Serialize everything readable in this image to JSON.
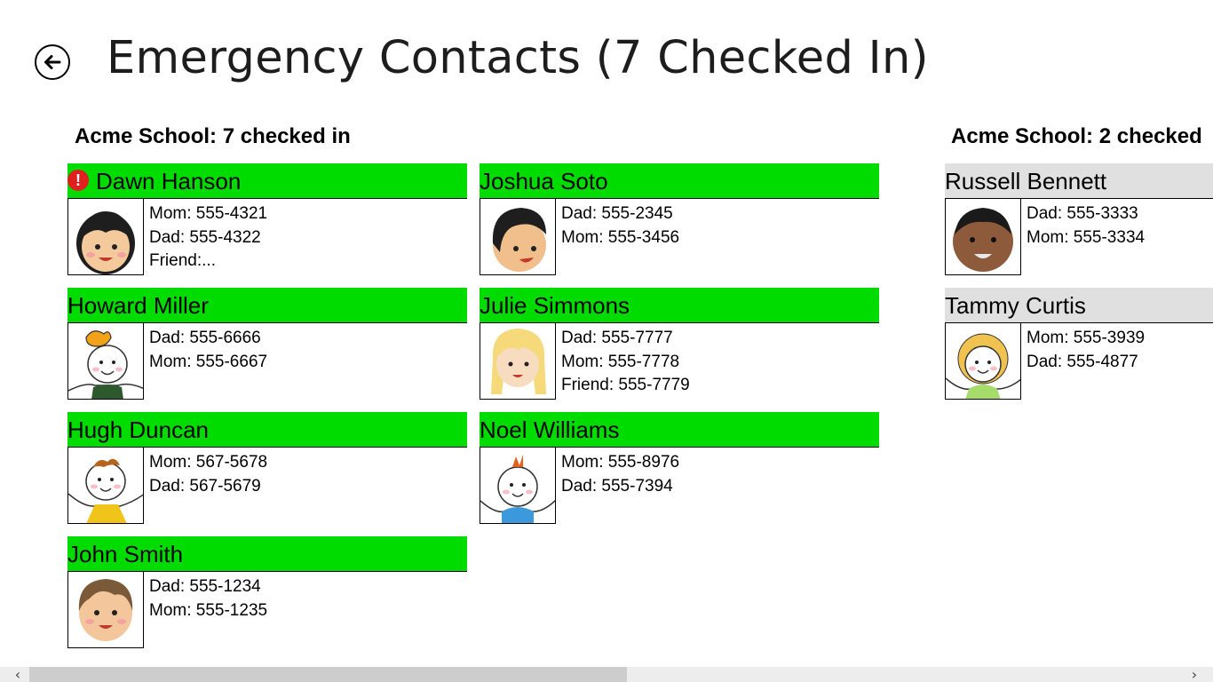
{
  "page": {
    "title": "Emergency Contacts (7 Checked In)"
  },
  "groups": [
    {
      "header": "Acme School: 7 checked in",
      "children": [
        {
          "name": "Dawn Hanson",
          "alert": true,
          "contacts": [
            "Mom: 555-4321",
            "Dad: 555-4322",
            "Friend:..."
          ]
        },
        {
          "name": "Joshua Soto",
          "contacts": [
            "Dad: 555-2345",
            "Mom: 555-3456"
          ]
        },
        {
          "name": "Howard Miller",
          "contacts": [
            "Dad: 555-6666",
            "Mom: 555-6667"
          ]
        },
        {
          "name": "Julie Simmons",
          "contacts": [
            "Dad: 555-7777",
            "Mom: 555-7778",
            "Friend: 555-7779"
          ]
        },
        {
          "name": "Hugh Duncan",
          "contacts": [
            "Mom: 567-5678",
            "Dad: 567-5679"
          ]
        },
        {
          "name": "Noel Williams",
          "contacts": [
            "Mom: 555-8976",
            "Dad: 555-7394"
          ]
        },
        {
          "name": "John Smith",
          "contacts": [
            "Dad: 555-1234",
            "Mom: 555-1235"
          ]
        }
      ]
    },
    {
      "header": "Acme School: 2 checked",
      "children": [
        {
          "name": "Russell Bennett",
          "contacts": [
            "Dad: 555-3333",
            "Mom: 555-3334"
          ]
        },
        {
          "name": "Tammy Curtis",
          "contacts": [
            "Mom: 555-3939",
            "Dad: 555-4877"
          ]
        }
      ]
    }
  ],
  "icons": {
    "back": "back-arrow-icon",
    "alert": "exclamation-alert-icon",
    "scroll_left": "chevron-left-icon",
    "scroll_right": "chevron-right-icon"
  },
  "colors": {
    "checked_in": "#00dc00",
    "not_checked_in": "#e0e0e0",
    "alert": "#e02020"
  },
  "alert_glyph": "!"
}
